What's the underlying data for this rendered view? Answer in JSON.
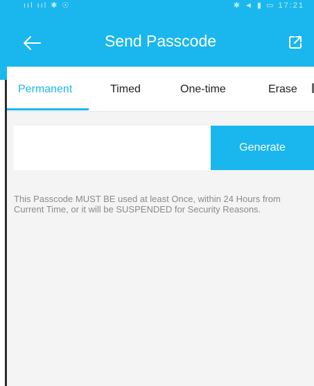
{
  "status_bar": {
    "left_text": "ııl ııl ✱ ☉",
    "right_text": "✱ ◄ ▮ ▭ 17:21"
  },
  "header": {
    "title": "Send Passcode",
    "back_icon": "arrow-left-icon",
    "share_icon": "external-link-icon"
  },
  "tabs": [
    {
      "label": "Permanent",
      "active": true
    },
    {
      "label": "Timed",
      "active": false
    },
    {
      "label": "One-time",
      "active": false
    },
    {
      "label": "Erase",
      "active": false
    }
  ],
  "passcode": {
    "value": "",
    "generate_label": "Generate"
  },
  "notice": "This Passcode MUST BE used at least Once, within 24 Hours from Current Time, or it will be SUSPENDED for Security Reasons.",
  "colors": {
    "accent": "#1ab7ee",
    "background": "#f4f4f4",
    "notice_text": "#8a8a8a"
  }
}
